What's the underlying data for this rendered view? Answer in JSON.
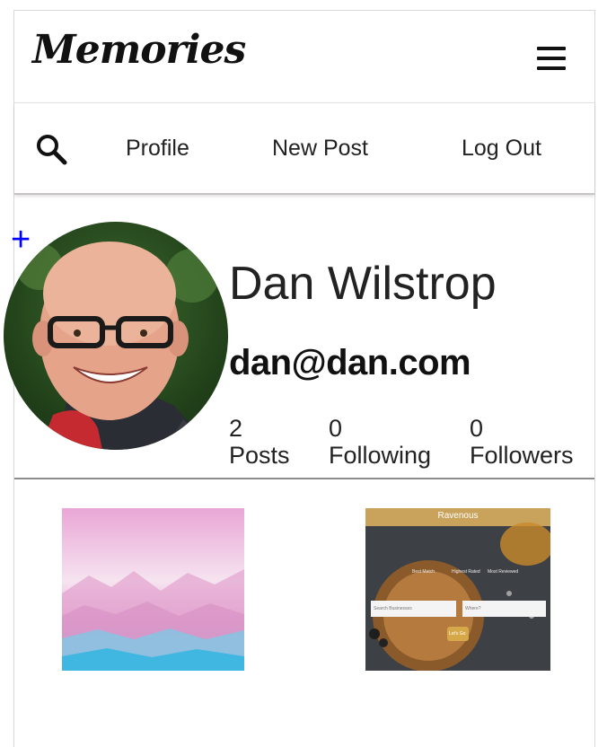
{
  "app": {
    "title": "Memories"
  },
  "nav": {
    "profile_label": "Profile",
    "new_post_label": "New Post",
    "logout_label": "Log Out"
  },
  "profile": {
    "add_label": "+",
    "name": "Dan Wilstrop",
    "email": "dan@dan.com",
    "stats": [
      {
        "value": "2",
        "label": "Posts"
      },
      {
        "value": "0",
        "label": "Following"
      },
      {
        "value": "0",
        "label": "Followers"
      }
    ]
  },
  "posts": [
    {
      "image": "pink-blue-mountains-landscape"
    },
    {
      "image": "ravenous-app-screenshot",
      "overlay": {
        "title": "Ravenous",
        "options": [
          "Best Match",
          "Highest Rated",
          "Most Reviewed"
        ],
        "inputs": [
          "Search Businesses",
          "Where?"
        ],
        "button": "Let's Go"
      }
    }
  ],
  "icons": {
    "menu": "hamburger-menu-icon",
    "search": "search-icon"
  },
  "colors": {
    "accent_plus": "#0000ff",
    "text": "#222222",
    "divider": "#8d8d8d"
  }
}
